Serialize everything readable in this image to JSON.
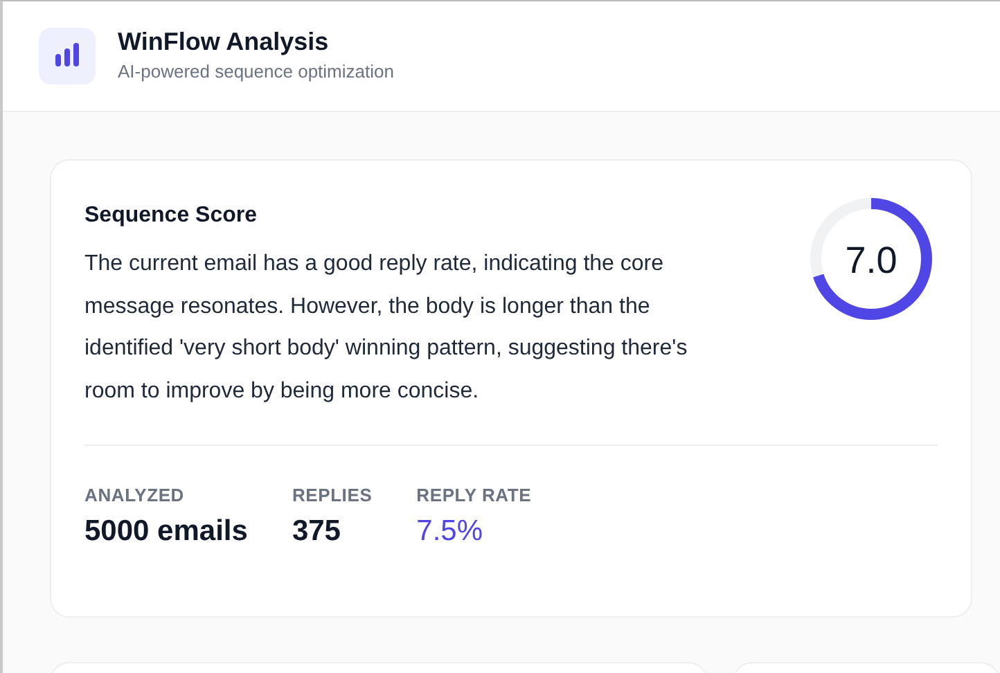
{
  "header": {
    "title": "WinFlow Analysis",
    "subtitle": "AI-powered sequence optimization"
  },
  "score_card": {
    "title": "Sequence Score",
    "summary": "The current email has a good reply rate, indicating the core message resonates. However, the body is longer than the identified 'very short body' winning pattern, suggesting there's room to improve by being more concise.",
    "score": "7.0",
    "level": 0.7,
    "stats": [
      {
        "label": "ANALYZED",
        "value": "5000 emails",
        "highlight": false
      },
      {
        "label": "REPLIES",
        "value": "375",
        "highlight": false
      },
      {
        "label": "REPLY RATE",
        "value": "7.5%",
        "highlight": true
      }
    ]
  }
}
